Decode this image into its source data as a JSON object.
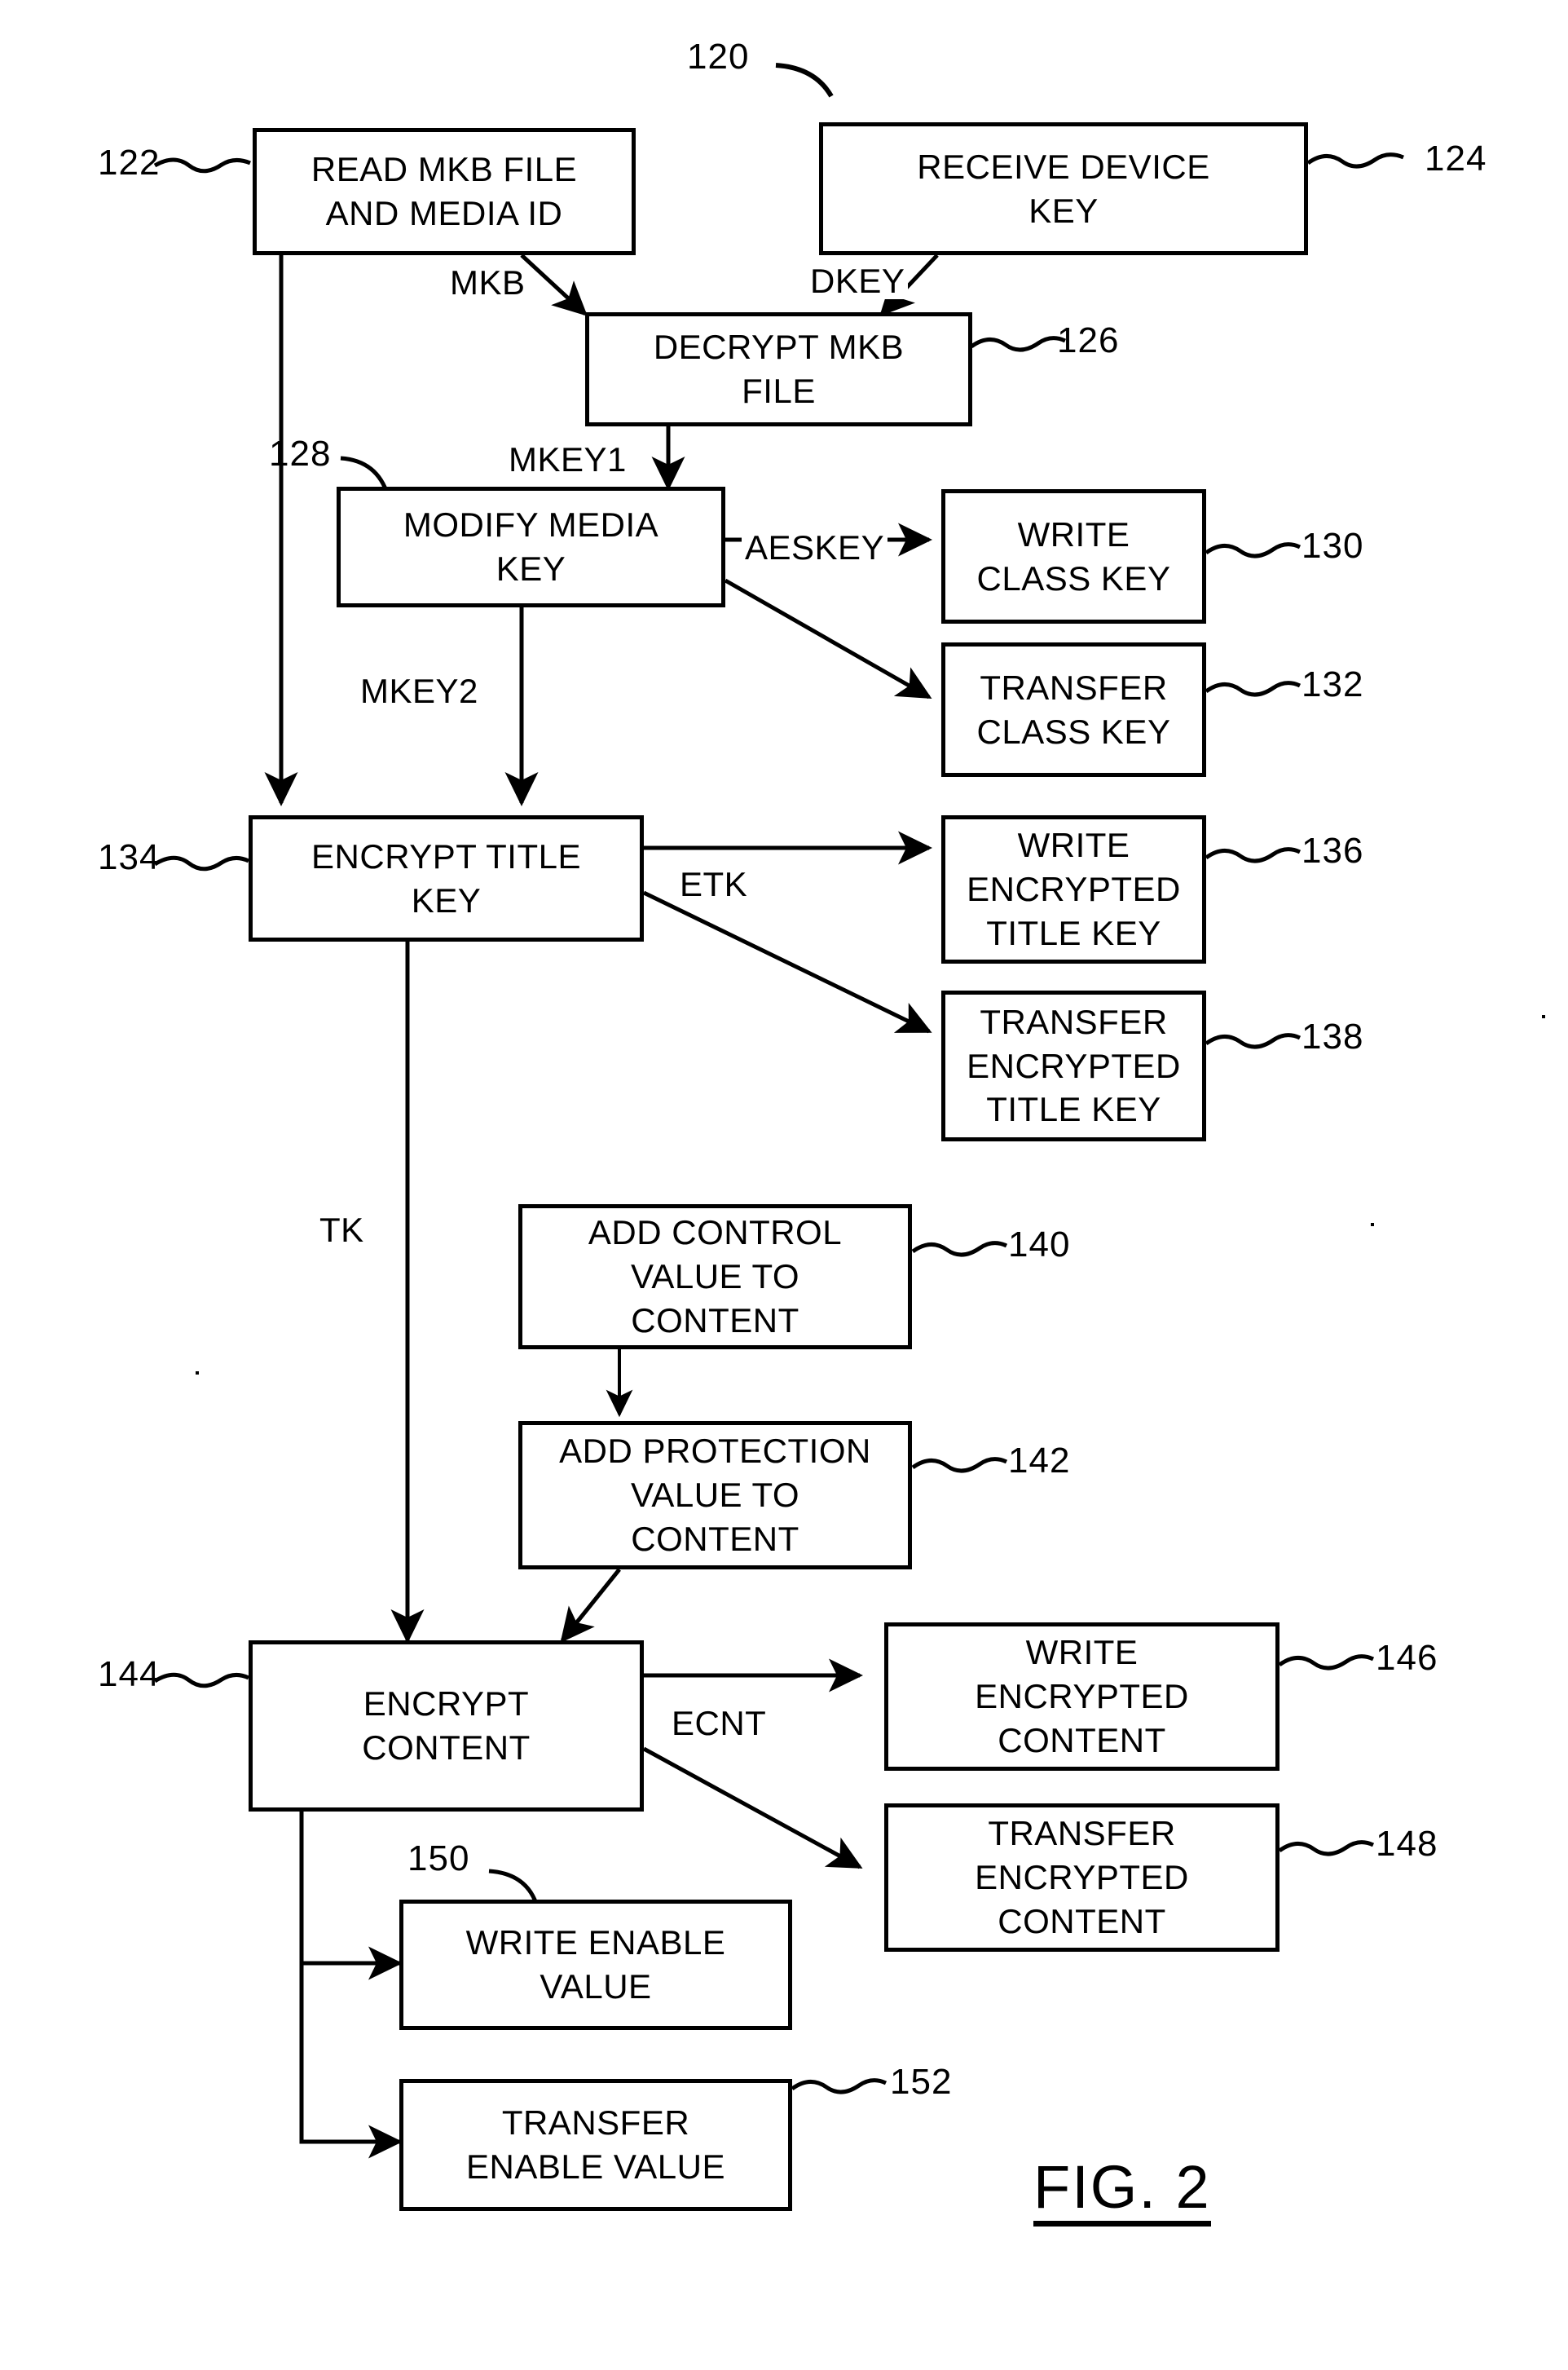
{
  "figure": {
    "label": "FIG. 2",
    "diagram_ref": "120"
  },
  "nodes": [
    {
      "id": "122",
      "ref": "122",
      "ref_side": "left",
      "text": "READ MKB FILE AND MEDIA ID"
    },
    {
      "id": "124",
      "ref": "124",
      "ref_side": "right",
      "text": "RECEIVE DEVICE KEY"
    },
    {
      "id": "126",
      "ref": "126",
      "ref_side": "right",
      "text": "DECRYPT MKB FILE"
    },
    {
      "id": "128",
      "ref": "128",
      "ref_side": "top-left",
      "text": "MODIFY MEDIA KEY"
    },
    {
      "id": "130",
      "ref": "130",
      "ref_side": "right",
      "text": "WRITE CLASS KEY"
    },
    {
      "id": "132",
      "ref": "132",
      "ref_side": "right",
      "text": "TRANSFER CLASS KEY"
    },
    {
      "id": "134",
      "ref": "134",
      "ref_side": "left",
      "text": "ENCRYPT TITLE KEY"
    },
    {
      "id": "136",
      "ref": "136",
      "ref_side": "right",
      "text": "WRITE ENCRYPTED TITLE KEY"
    },
    {
      "id": "138",
      "ref": "138",
      "ref_side": "right",
      "text": "TRANSFER ENCRYPTED TITLE KEY"
    },
    {
      "id": "140",
      "ref": "140",
      "ref_side": "right",
      "text": "ADD CONTROL VALUE TO CONTENT"
    },
    {
      "id": "142",
      "ref": "142",
      "ref_side": "right",
      "text": "ADD PROTECTION VALUE TO CONTENT"
    },
    {
      "id": "144",
      "ref": "144",
      "ref_side": "left",
      "text": "ENCRYPT CONTENT"
    },
    {
      "id": "146",
      "ref": "146",
      "ref_side": "right",
      "text": "WRITE ENCRYPTED CONTENT"
    },
    {
      "id": "148",
      "ref": "148",
      "ref_side": "right",
      "text": "TRANSFER ENCRYPTED CONTENT"
    },
    {
      "id": "150",
      "ref": "150",
      "ref_side": "top-left",
      "text": "WRITE ENABLE VALUE"
    },
    {
      "id": "152",
      "ref": "152",
      "ref_side": "right",
      "text": "TRANSFER ENABLE VALUE"
    }
  ],
  "node_text": {
    "n122_l1": "READ MKB FILE",
    "n122_l2": "AND MEDIA ID",
    "n124_l1": "RECEIVE DEVICE",
    "n124_l2": "KEY",
    "n126_l1": "DECRYPT MKB",
    "n126_l2": "FILE",
    "n128_l1": "MODIFY MEDIA",
    "n128_l2": "KEY",
    "n130_l1": "WRITE",
    "n130_l2": "CLASS KEY",
    "n132_l1": "TRANSFER",
    "n132_l2": "CLASS KEY",
    "n134_l1": "ENCRYPT TITLE",
    "n134_l2": "KEY",
    "n136_l1": "WRITE",
    "n136_l2": "ENCRYPTED",
    "n136_l3": "TITLE KEY",
    "n138_l1": "TRANSFER",
    "n138_l2": "ENCRYPTED",
    "n138_l3": "TITLE KEY",
    "n140_l1": "ADD CONTROL",
    "n140_l2": "VALUE TO",
    "n140_l3": "CONTENT",
    "n142_l1": "ADD PROTECTION",
    "n142_l2": "VALUE TO",
    "n142_l3": "CONTENT",
    "n144_l1": "ENCRYPT",
    "n144_l2": "CONTENT",
    "n146_l1": "WRITE",
    "n146_l2": "ENCRYPTED",
    "n146_l3": "CONTENT",
    "n148_l1": "TRANSFER",
    "n148_l2": "ENCRYPTED",
    "n148_l3": "CONTENT",
    "n150_l1": "WRITE ENABLE",
    "n150_l2": "VALUE",
    "n152_l1": "TRANSFER",
    "n152_l2": "ENABLE VALUE"
  },
  "refs": {
    "r120": "120",
    "r122": "122",
    "r124": "124",
    "r126": "126",
    "r128": "128",
    "r130": "130",
    "r132": "132",
    "r134": "134",
    "r136": "136",
    "r138": "138",
    "r140": "140",
    "r142": "142",
    "r144": "144",
    "r146": "146",
    "r148": "148",
    "r150": "150",
    "r152": "152"
  },
  "edge_labels": {
    "mkb": "MKB",
    "dkey": "DKEY",
    "mkey1": "MKEY1",
    "mkey2": "MKEY2",
    "aeskey": "AESKEY",
    "etk": "ETK",
    "tk": "TK",
    "ecnt": "ECNT"
  },
  "edges": [
    {
      "from": "122",
      "to": "126",
      "label": "MKB"
    },
    {
      "from": "124",
      "to": "126",
      "label": "DKEY"
    },
    {
      "from": "126",
      "to": "128",
      "label": "MKEY1"
    },
    {
      "from": "128",
      "to": "130",
      "label": "AESKEY"
    },
    {
      "from": "128",
      "to": "132",
      "label": "AESKEY"
    },
    {
      "from": "128",
      "to": "134",
      "label": "MKEY2"
    },
    {
      "from": "122",
      "to": "134",
      "label": ""
    },
    {
      "from": "134",
      "to": "136",
      "label": "ETK"
    },
    {
      "from": "134",
      "to": "138",
      "label": "ETK"
    },
    {
      "from": "134",
      "to": "144",
      "label": "TK"
    },
    {
      "from": "140",
      "to": "142",
      "label": ""
    },
    {
      "from": "142",
      "to": "144",
      "label": ""
    },
    {
      "from": "144",
      "to": "146",
      "label": "ECNT"
    },
    {
      "from": "144",
      "to": "148",
      "label": "ECNT"
    },
    {
      "from": "144",
      "to": "150",
      "label": ""
    },
    {
      "from": "144",
      "to": "152",
      "label": ""
    }
  ],
  "colors": {
    "stroke": "#000000",
    "background": "#ffffff"
  }
}
